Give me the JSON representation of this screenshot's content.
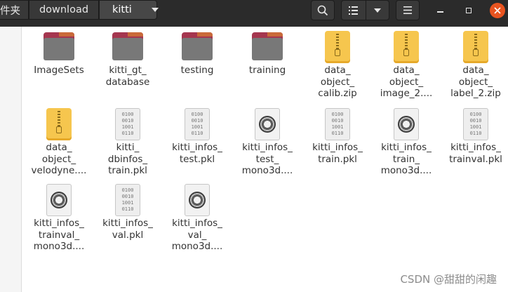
{
  "pathbar": {
    "crumbs": [
      "件夹",
      "download",
      "kitti"
    ]
  },
  "toolbar": {
    "search_icon": "search-icon",
    "view_icon": "list-view-icon",
    "view_menu_icon": "chevron-down-icon",
    "menu_icon": "hamburger-menu-icon"
  },
  "window": {
    "minimize": "–",
    "maximize": "□",
    "close": "×",
    "close_color": "#e95420"
  },
  "files": [
    {
      "label": "ImageSets",
      "kind": "folder"
    },
    {
      "label": "kitti_gt_\ndatabase",
      "kind": "folder"
    },
    {
      "label": "testing",
      "kind": "folder"
    },
    {
      "label": "training",
      "kind": "folder"
    },
    {
      "label": "data_\nobject_\ncalib.zip",
      "kind": "zip"
    },
    {
      "label": "data_\nobject_\nimage_2....",
      "kind": "zip"
    },
    {
      "label": "data_\nobject_\nlabel_2.zip",
      "kind": "zip"
    },
    {
      "label": "data_\nobject_\nvelodyne....",
      "kind": "zip"
    },
    {
      "label": "kitti_\ndbinfos_\ntrain.pkl",
      "kind": "binary"
    },
    {
      "label": "kitti_infos_\ntest.pkl",
      "kind": "binary"
    },
    {
      "label": "kitti_infos_\ntest_\nmono3d....",
      "kind": "generic"
    },
    {
      "label": "kitti_infos_\ntrain.pkl",
      "kind": "binary"
    },
    {
      "label": "kitti_infos_\ntrain_\nmono3d....",
      "kind": "generic"
    },
    {
      "label": "kitti_infos_\ntrainval.pkl",
      "kind": "binary"
    },
    {
      "label": "kitti_infos_\ntrainval_\nmono3d....",
      "kind": "generic"
    },
    {
      "label": "kitti_infos_\nval.pkl",
      "kind": "binary"
    },
    {
      "label": "kitti_infos_\nval_\nmono3d....",
      "kind": "generic"
    }
  ],
  "binary_bits": "0100\n0010\n1001\n0110",
  "watermark": "CSDN @甜甜的闲趣"
}
